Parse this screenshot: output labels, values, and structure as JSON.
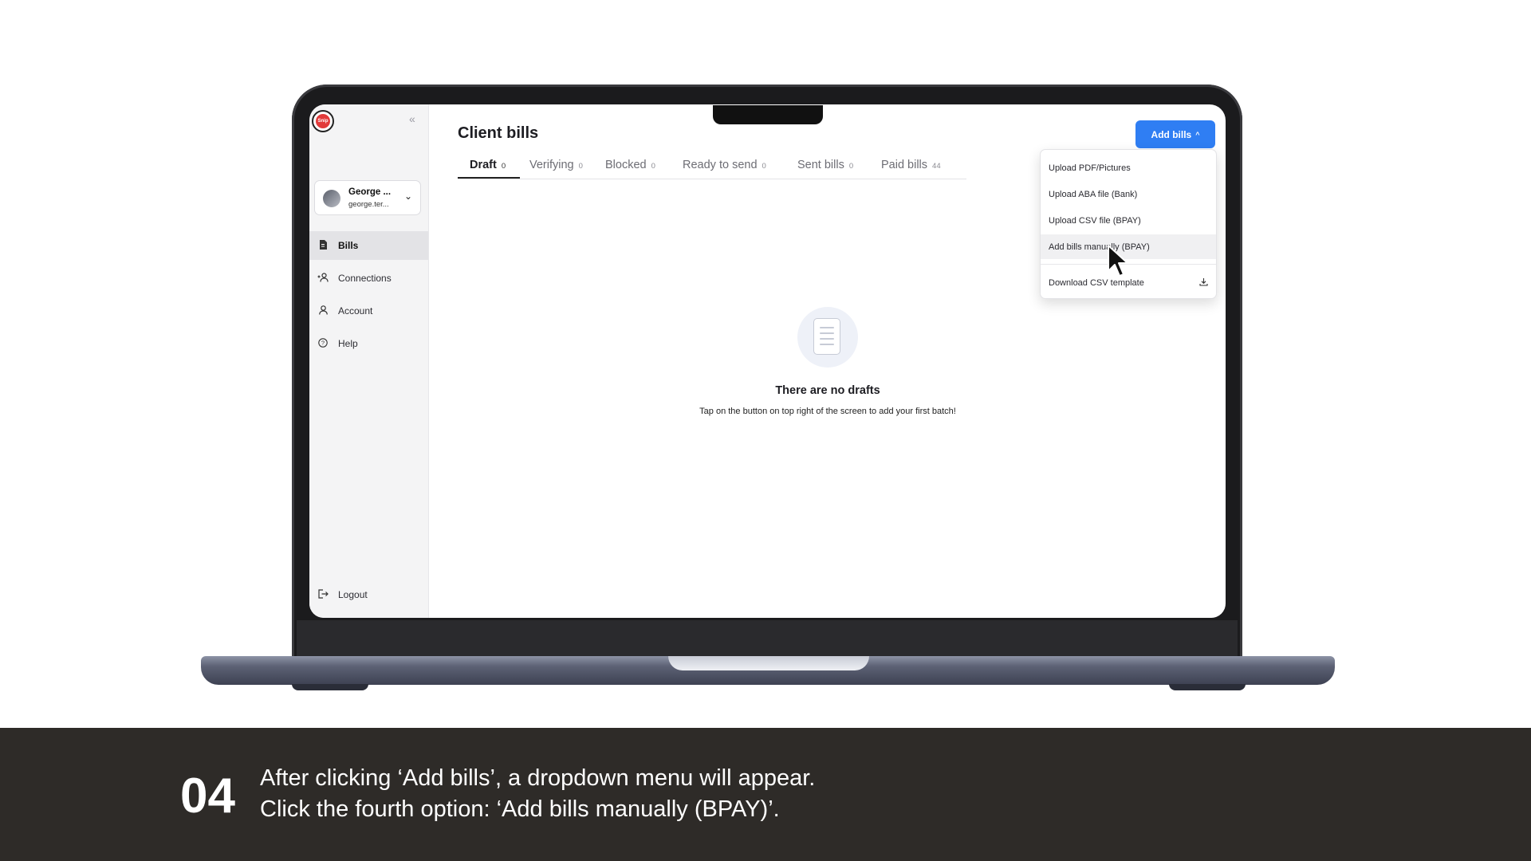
{
  "app": {
    "logo_text": "Snip",
    "collapse_icon": "double-chevron-left-icon"
  },
  "user": {
    "name": "George ...",
    "email": "george.ter..."
  },
  "sidebar": {
    "items": [
      {
        "label": "Bills",
        "icon": "document-icon",
        "active": true
      },
      {
        "label": "Connections",
        "icon": "user-plus-icon",
        "active": false
      },
      {
        "label": "Account",
        "icon": "user-icon",
        "active": false
      },
      {
        "label": "Help",
        "icon": "help-circle-icon",
        "active": false
      }
    ],
    "logout": "Logout"
  },
  "page": {
    "title": "Client bills"
  },
  "tabs": [
    {
      "label": "Draft",
      "count": "0"
    },
    {
      "label": "Verifying",
      "count": "0"
    },
    {
      "label": "Blocked",
      "count": "0"
    },
    {
      "label": "Ready to send",
      "count": "0"
    },
    {
      "label": "Sent bills",
      "count": "0"
    },
    {
      "label": "Paid bills",
      "count": "44"
    }
  ],
  "add_bills": {
    "label": "Add bills",
    "color": "#2f7ef3"
  },
  "dropdown": {
    "items": [
      "Upload PDF/Pictures",
      "Upload ABA file (Bank)",
      "Upload CSV file (BPAY)",
      "Add bills manually (BPAY)"
    ],
    "download": "Download CSV template"
  },
  "empty_state": {
    "title": "There are no drafts",
    "subtitle": "Tap on the button on top right of the screen to add your first batch!"
  },
  "caption": {
    "step": "04",
    "line1": "After clicking ‘Add bills’, a dropdown menu will appear.",
    "line2": "Click the fourth option: ‘Add bills manually (BPAY)’."
  }
}
